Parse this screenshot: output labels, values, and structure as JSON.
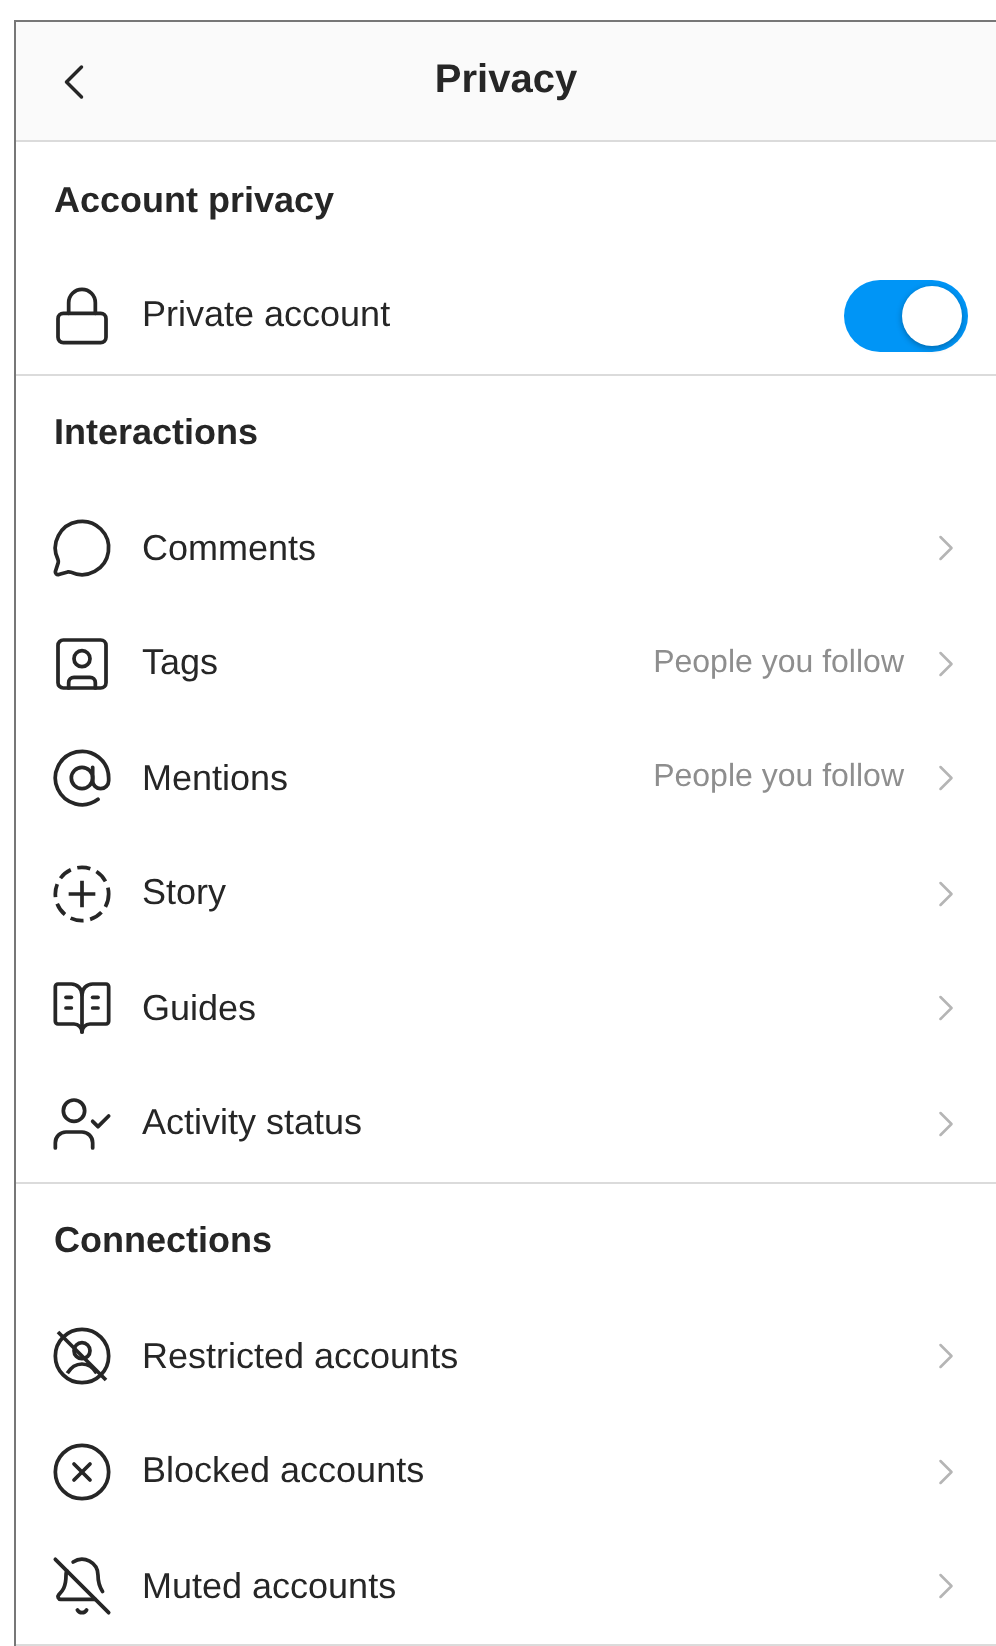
{
  "header": {
    "title": "Privacy"
  },
  "sections": [
    {
      "title": "Account privacy",
      "rows": [
        {
          "kind": "toggle",
          "label": "Private account",
          "on": true
        }
      ]
    },
    {
      "title": "Interactions",
      "rows": [
        {
          "kind": "link",
          "label": "Comments"
        },
        {
          "kind": "link",
          "label": "Tags",
          "value": "People you follow"
        },
        {
          "kind": "link",
          "label": "Mentions",
          "value": "People you follow"
        },
        {
          "kind": "link",
          "label": "Story"
        },
        {
          "kind": "link",
          "label": "Guides"
        },
        {
          "kind": "link",
          "label": "Activity status"
        }
      ]
    },
    {
      "title": "Connections",
      "rows": [
        {
          "kind": "link",
          "label": "Restricted accounts"
        },
        {
          "kind": "link",
          "label": "Blocked accounts"
        },
        {
          "kind": "link",
          "label": "Muted accounts"
        }
      ]
    }
  ]
}
